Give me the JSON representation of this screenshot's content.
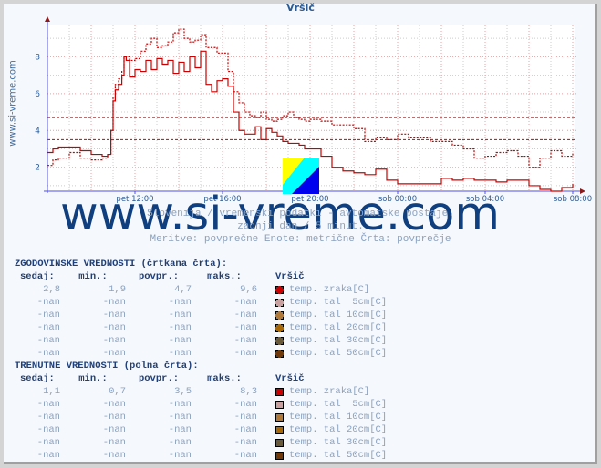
{
  "page": {
    "title": "Vršič",
    "side_label": "www.si-vreme.com",
    "watermark": "www.si-vreme.com",
    "info_lines": [
      "Slovenija / vremenski podatki - avtomatske postaje.",
      "zadnji dan / 5 minut.",
      "Meritve: povprečne  Enote: metrične  Črta: povprečje"
    ]
  },
  "tables": {
    "historical": {
      "title": "ZGODOVINSKE VREDNOSTI (črtkana črta):",
      "headers": [
        "sedaj:",
        "min.:",
        "povpr.:",
        "maks.:",
        "Vršič"
      ],
      "rows": [
        {
          "sedaj": "2,8",
          "min": "1,9",
          "povpr": "4,7",
          "maks": "9,6",
          "name": "temp. zraka[C]",
          "color": "#cc0000"
        },
        {
          "sedaj": "-nan",
          "min": "-nan",
          "povpr": "-nan",
          "maks": "-nan",
          "name": "temp. tal  5cm[C]",
          "color": "#c8a0a0"
        },
        {
          "sedaj": "-nan",
          "min": "-nan",
          "povpr": "-nan",
          "maks": "-nan",
          "name": "temp. tal 10cm[C]",
          "color": "#b07838"
        },
        {
          "sedaj": "-nan",
          "min": "-nan",
          "povpr": "-nan",
          "maks": "-nan",
          "name": "temp. tal 20cm[C]",
          "color": "#a86808"
        },
        {
          "sedaj": "-nan",
          "min": "-nan",
          "povpr": "-nan",
          "maks": "-nan",
          "name": "temp. tal 30cm[C]",
          "color": "#6a5a3a"
        },
        {
          "sedaj": "-nan",
          "min": "-nan",
          "povpr": "-nan",
          "maks": "-nan",
          "name": "temp. tal 50cm[C]",
          "color": "#703808"
        }
      ]
    },
    "current": {
      "title": "TRENUTNE VREDNOSTI (polna črta):",
      "headers": [
        "sedaj:",
        "min.:",
        "povpr.:",
        "maks.:",
        "Vršič"
      ],
      "rows": [
        {
          "sedaj": "1,1",
          "min": "0,7",
          "povpr": "3,5",
          "maks": "8,3",
          "name": "temp. zraka[C]",
          "color": "#cc0000"
        },
        {
          "sedaj": "-nan",
          "min": "-nan",
          "povpr": "-nan",
          "maks": "-nan",
          "name": "temp. tal  5cm[C]",
          "color": "#c8a0a0"
        },
        {
          "sedaj": "-nan",
          "min": "-nan",
          "povpr": "-nan",
          "maks": "-nan",
          "name": "temp. tal 10cm[C]",
          "color": "#b07838"
        },
        {
          "sedaj": "-nan",
          "min": "-nan",
          "povpr": "-nan",
          "maks": "-nan",
          "name": "temp. tal 20cm[C]",
          "color": "#a86808"
        },
        {
          "sedaj": "-nan",
          "min": "-nan",
          "povpr": "-nan",
          "maks": "-nan",
          "name": "temp. tal 30cm[C]",
          "color": "#6a5a3a"
        },
        {
          "sedaj": "-nan",
          "min": "-nan",
          "povpr": "-nan",
          "maks": "-nan",
          "name": "temp. tal 50cm[C]",
          "color": "#703808"
        }
      ]
    }
  },
  "chart_data": {
    "type": "line",
    "title": "Vršič",
    "xlabel": "",
    "ylabel": "",
    "x_unit": "hours since pet 08:00",
    "xlim": [
      0,
      24
    ],
    "ylim": [
      0.7,
      9.7
    ],
    "xticks": [
      {
        "x": 4,
        "label": "pet 12:00"
      },
      {
        "x": 8,
        "label": "pet 16:00"
      },
      {
        "x": 12,
        "label": "pet 20:00"
      },
      {
        "x": 16,
        "label": "sob 00:00"
      },
      {
        "x": 20,
        "label": "sob 04:00"
      },
      {
        "x": 24,
        "label": "sob 08:00"
      }
    ],
    "yticks": [
      2,
      4,
      6,
      8
    ],
    "grid": true,
    "colors": {
      "line": "#cc0000",
      "axis": "#5050e0",
      "grid_major": "#e8a0a0",
      "grid_minor": "#cccccc"
    },
    "hlines": [
      {
        "name": "historical average",
        "value": 4.7
      },
      {
        "name": "current average",
        "value": 3.5
      }
    ],
    "series": [
      {
        "name": "temp. zraka[C] (trenutne, polna črta)",
        "style": "solid",
        "x": [
          0,
          0.25,
          0.5,
          1.0,
          1.5,
          2.0,
          2.5,
          2.75,
          2.9,
          3.0,
          3.1,
          3.25,
          3.4,
          3.5,
          3.6,
          3.75,
          4.0,
          4.25,
          4.5,
          4.75,
          5.0,
          5.25,
          5.5,
          5.75,
          6.0,
          6.25,
          6.5,
          6.75,
          7.0,
          7.25,
          7.5,
          7.75,
          8.0,
          8.25,
          8.5,
          8.75,
          9.0,
          9.25,
          9.5,
          9.75,
          10.0,
          10.25,
          10.5,
          10.75,
          11.0,
          11.25,
          11.5,
          11.75,
          12.0,
          12.5,
          13.0,
          13.5,
          14.0,
          14.5,
          15.0,
          15.5,
          16.0,
          16.5,
          17.0,
          17.5,
          18.0,
          18.5,
          19.0,
          19.5,
          20.0,
          20.5,
          21.0,
          21.5,
          22.0,
          22.5,
          23.0,
          23.5,
          24.0
        ],
        "values": [
          2.8,
          3.0,
          3.1,
          3.1,
          2.9,
          2.7,
          2.6,
          2.7,
          4.0,
          5.6,
          6.2,
          6.5,
          7.0,
          8.0,
          7.8,
          6.9,
          7.3,
          7.2,
          7.8,
          7.3,
          7.9,
          7.6,
          7.8,
          7.1,
          7.7,
          7.2,
          8.0,
          7.4,
          8.3,
          6.5,
          6.1,
          6.7,
          6.8,
          6.4,
          5.0,
          4.0,
          3.8,
          3.8,
          4.2,
          3.5,
          4.1,
          3.9,
          3.7,
          3.4,
          3.3,
          3.3,
          3.2,
          3.0,
          3.0,
          2.6,
          2.0,
          1.8,
          1.7,
          1.6,
          1.9,
          1.3,
          1.1,
          1.1,
          1.1,
          1.1,
          1.4,
          1.3,
          1.4,
          1.3,
          1.3,
          1.2,
          1.3,
          1.3,
          1.0,
          0.8,
          0.7,
          0.9,
          1.1
        ]
      },
      {
        "name": "temp. zraka[C] (zgodovinske, črtkana črta)",
        "style": "dashed",
        "x": [
          0,
          0.25,
          0.5,
          1.0,
          1.5,
          2.0,
          2.5,
          2.75,
          2.9,
          3.0,
          3.1,
          3.25,
          3.4,
          3.5,
          3.75,
          4.0,
          4.25,
          4.5,
          4.75,
          5.0,
          5.25,
          5.5,
          5.75,
          6.0,
          6.25,
          6.5,
          6.75,
          7.0,
          7.25,
          7.5,
          7.75,
          8.0,
          8.25,
          8.5,
          8.75,
          9.0,
          9.25,
          9.5,
          9.75,
          10.0,
          10.25,
          10.5,
          10.75,
          11.0,
          11.25,
          11.5,
          11.75,
          12.0,
          12.5,
          13.0,
          13.5,
          14.0,
          14.5,
          15.0,
          15.5,
          16.0,
          16.5,
          17.0,
          17.5,
          18.0,
          18.5,
          19.0,
          19.5,
          20.0,
          20.5,
          21.0,
          21.5,
          22.0,
          22.5,
          23.0,
          23.5,
          24.0
        ],
        "values": [
          2.1,
          2.4,
          2.5,
          2.8,
          2.5,
          2.4,
          2.5,
          2.7,
          4.0,
          5.8,
          6.5,
          6.8,
          7.2,
          8.0,
          7.8,
          7.9,
          8.3,
          8.7,
          9.0,
          8.5,
          8.6,
          8.8,
          9.3,
          9.5,
          9.0,
          8.8,
          8.9,
          9.2,
          8.5,
          8.5,
          8.2,
          8.2,
          7.2,
          6.1,
          5.5,
          5.0,
          4.8,
          4.7,
          5.0,
          4.6,
          4.5,
          4.6,
          4.8,
          5.0,
          4.7,
          4.6,
          4.5,
          4.6,
          4.5,
          4.3,
          4.3,
          4.1,
          3.4,
          3.6,
          3.5,
          3.8,
          3.6,
          3.6,
          3.4,
          3.4,
          3.2,
          3.0,
          2.5,
          2.6,
          2.8,
          2.9,
          2.6,
          2.0,
          2.5,
          2.9,
          2.6,
          2.8
        ]
      }
    ]
  }
}
